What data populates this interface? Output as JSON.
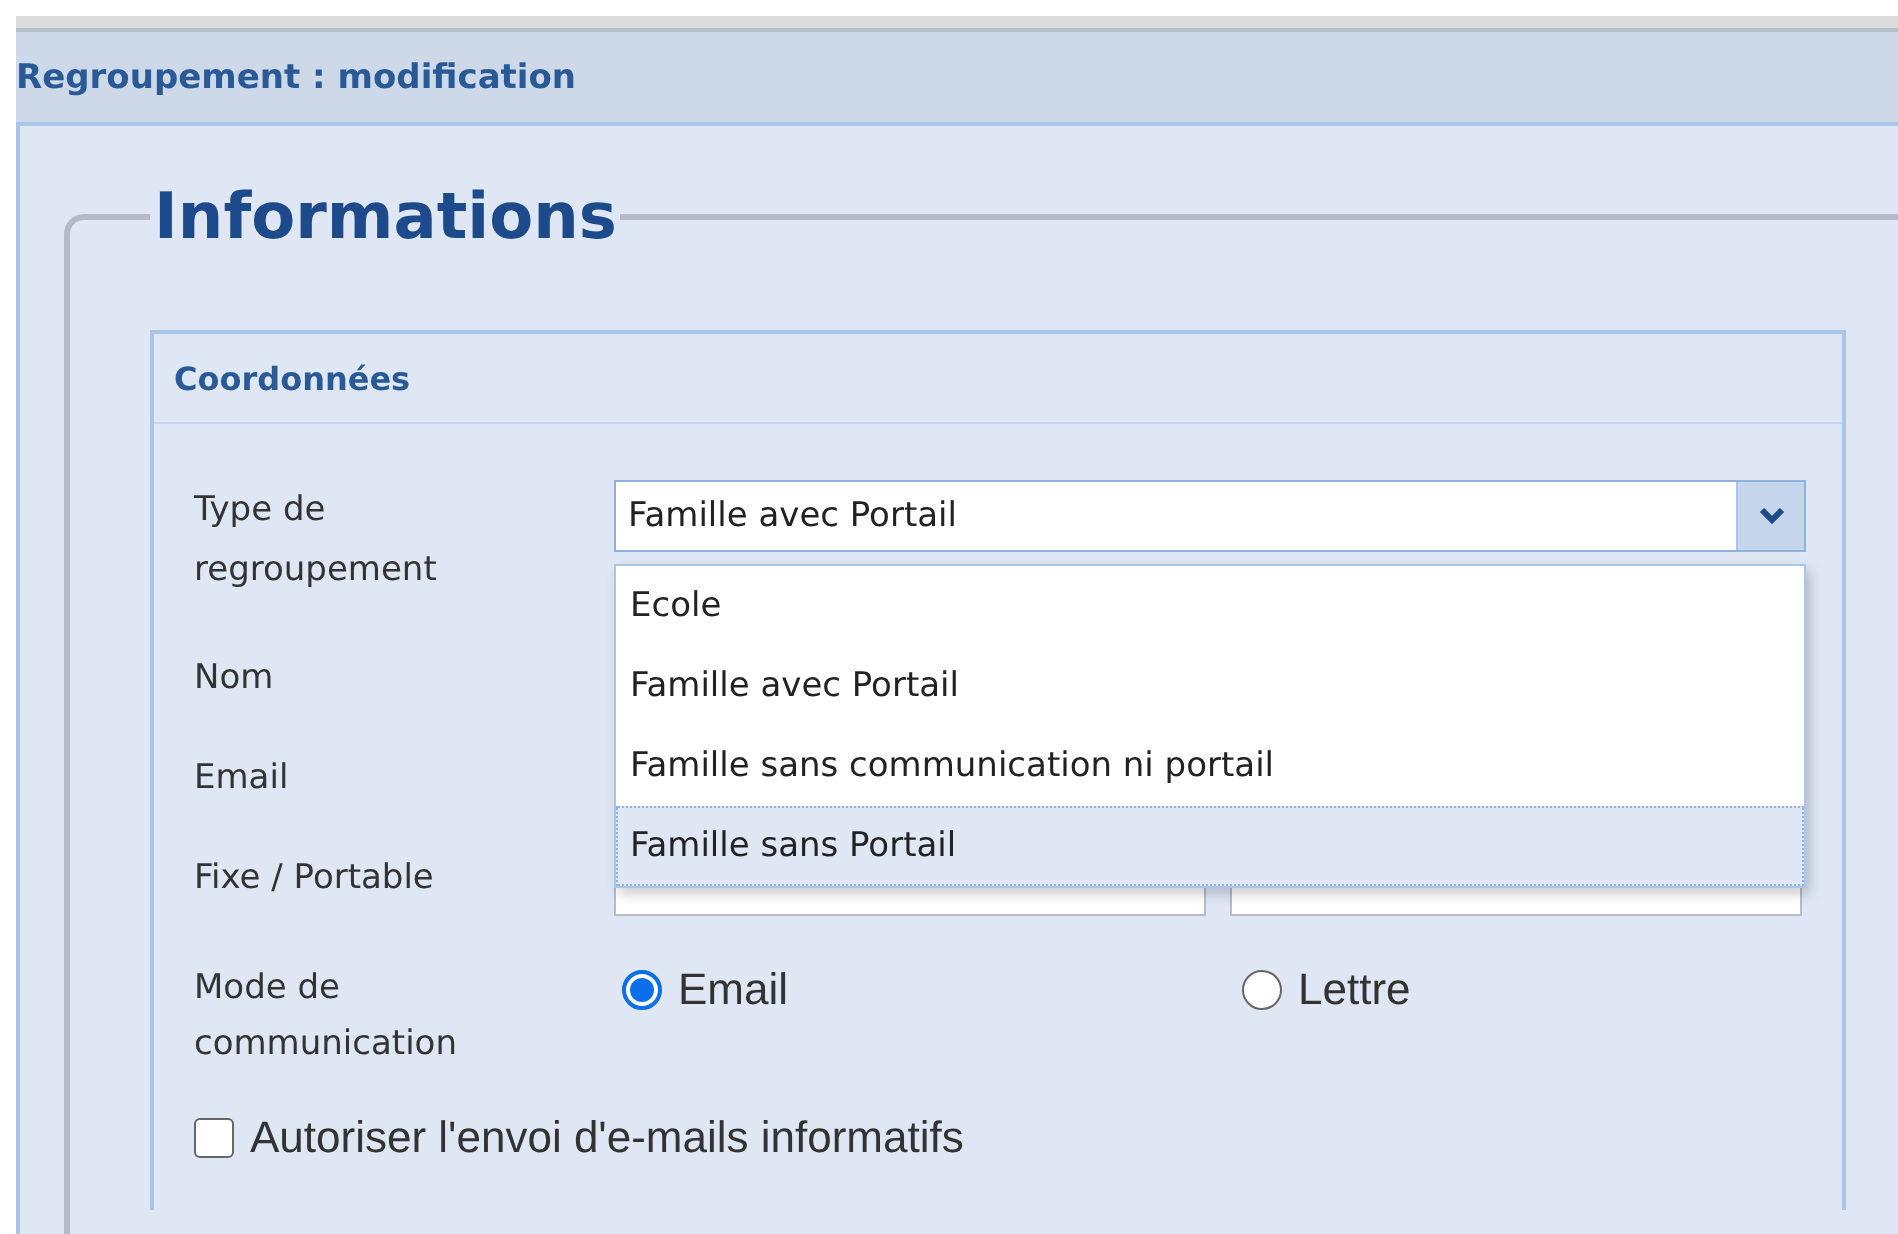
{
  "window": {
    "title": "Regroupement : modification"
  },
  "fieldset": {
    "legend": "Informations"
  },
  "panel": {
    "title": "Coordonnées"
  },
  "type_field": {
    "label": "Type de regroupement",
    "value": "Famille avec Portail",
    "expanded": true,
    "options": [
      {
        "label": "Ecole",
        "highlighted": false
      },
      {
        "label": "Famille avec Portail",
        "highlighted": false
      },
      {
        "label": "Famille sans communication ni portail",
        "highlighted": false
      },
      {
        "label": "Famille sans Portail",
        "highlighted": true
      }
    ]
  },
  "fields": [
    {
      "label": "Nom"
    },
    {
      "label": "Email"
    },
    {
      "label": "Fixe / Portable"
    }
  ],
  "communication": {
    "label": "Mode de communication",
    "options": [
      {
        "label": "Email",
        "selected": true
      },
      {
        "label": "Lettre",
        "selected": false
      }
    ]
  },
  "consent": {
    "label": "Autoriser l'envoi d'e-mails informatifs",
    "checked": false
  }
}
